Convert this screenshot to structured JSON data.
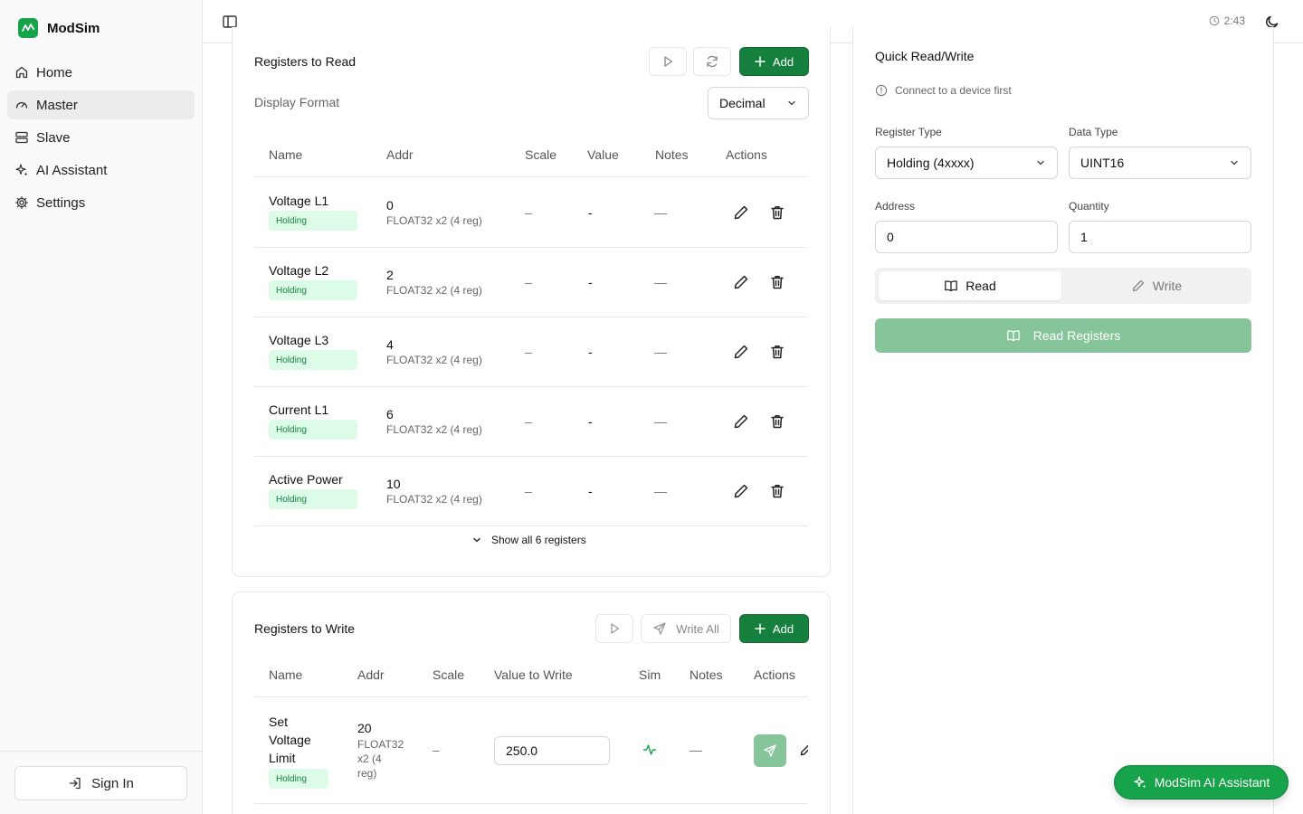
{
  "app": {
    "name": "ModSim",
    "clock": "2:43"
  },
  "nav": [
    {
      "label": "Home",
      "icon": "home-icon"
    },
    {
      "label": "Master",
      "icon": "gauge-icon",
      "active": true
    },
    {
      "label": "Slave",
      "icon": "server-icon"
    },
    {
      "label": "AI Assistant",
      "icon": "sparkles-icon"
    },
    {
      "label": "Settings",
      "icon": "gear-icon"
    }
  ],
  "signin_label": "Sign In",
  "read": {
    "title": "Registers to Read",
    "add_label": "Add",
    "format_label": "Display Format",
    "format_value": "Decimal",
    "columns": [
      "Name",
      "Addr",
      "Scale",
      "Value",
      "Notes",
      "Actions"
    ],
    "rows": [
      {
        "name": "Voltage L1",
        "type": "Holding",
        "addr": "0",
        "addr_sub": "FLOAT32 x2 (4 reg)",
        "scale": "–",
        "value": "-",
        "notes": "—"
      },
      {
        "name": "Voltage L2",
        "type": "Holding",
        "addr": "2",
        "addr_sub": "FLOAT32 x2 (4 reg)",
        "scale": "–",
        "value": "-",
        "notes": "—"
      },
      {
        "name": "Voltage L3",
        "type": "Holding",
        "addr": "4",
        "addr_sub": "FLOAT32 x2 (4 reg)",
        "scale": "–",
        "value": "-",
        "notes": "—"
      },
      {
        "name": "Current L1",
        "type": "Holding",
        "addr": "6",
        "addr_sub": "FLOAT32 x2 (4 reg)",
        "scale": "–",
        "value": "-",
        "notes": "—"
      },
      {
        "name": "Active Power",
        "type": "Holding",
        "addr": "10",
        "addr_sub": "FLOAT32 x2 (4 reg)",
        "scale": "–",
        "value": "-",
        "notes": "—"
      }
    ],
    "show_all_label": "Show all 6 registers"
  },
  "write": {
    "title": "Registers to Write",
    "write_all_label": "Write All",
    "add_label": "Add",
    "columns": [
      "Name",
      "Addr",
      "Scale",
      "Value to Write",
      "Sim",
      "Notes",
      "Actions"
    ],
    "rows": [
      {
        "name_lines": [
          "Set",
          "Voltage",
          "Limit"
        ],
        "type": "Holding",
        "addr": "20",
        "addr_sub_lines": [
          "FLOAT32",
          "x2 (4",
          "reg)"
        ],
        "scale": "–",
        "value": "250.0",
        "notes": "—"
      }
    ]
  },
  "quick": {
    "title": "Quick Read/Write",
    "hint": "Connect to a device first",
    "register_type_label": "Register Type",
    "register_type_value": "Holding (4xxxx)",
    "data_type_label": "Data Type",
    "data_type_value": "UINT16",
    "address_label": "Address",
    "address_value": "0",
    "quantity_label": "Quantity",
    "quantity_value": "1",
    "tab_read": "Read",
    "tab_write": "Write",
    "read_button": "Read Registers"
  },
  "ai_fab_label": "ModSim AI Assistant",
  "colors": {
    "primary": "#16a34a",
    "primary_dark": "#15803d",
    "badge_bg": "#dcfce7",
    "disabled_green": "#86c49a"
  }
}
